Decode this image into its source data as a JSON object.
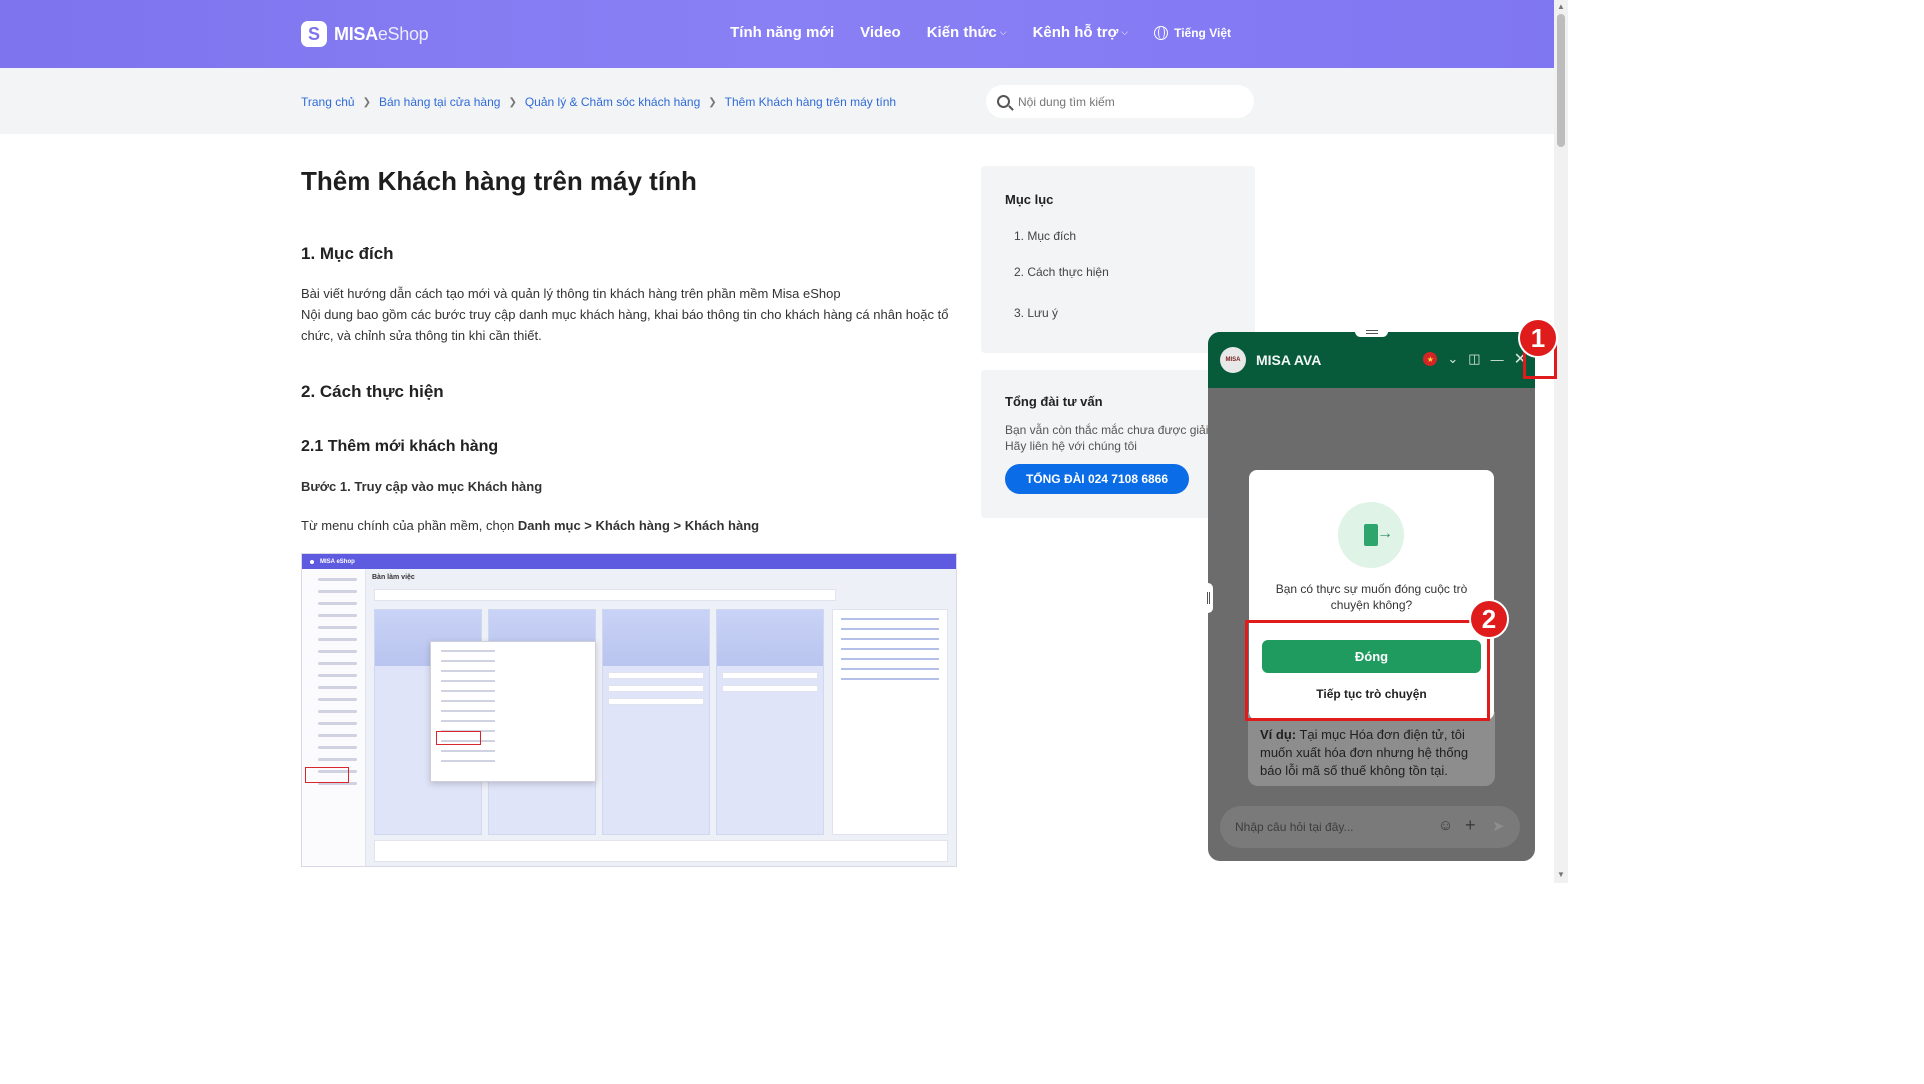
{
  "header": {
    "logo_brand": "MISA",
    "logo_product": "eShop",
    "nav": [
      "Tính năng mới",
      "Video",
      "Kiến thức",
      "Kênh hỗ trợ"
    ],
    "language": "Tiếng Việt"
  },
  "breadcrumb": [
    "Trang chủ",
    "Bán hàng tại cửa hàng",
    "Quản lý & Chăm sóc khách hàng",
    "Thêm Khách hàng trên máy tính"
  ],
  "search": {
    "placeholder": "Nội dung tìm kiếm"
  },
  "article": {
    "title": "Thêm Khách hàng trên máy tính",
    "section1_title": "1. Mục đích",
    "section1_p1": "Bài viết hướng dẫn cách tạo mới và quản lý thông tin khách hàng trên phần mềm Misa eShop",
    "section1_p2": "Nội dung bao gồm các bước truy cập danh mục khách hàng, khai báo thông tin cho khách hàng cá nhân hoặc tổ chức, và chỉnh sửa thông tin khi cần thiết.",
    "section2_title": "2. Cách thực hiện",
    "section21_title": "2.1 Thêm mới khách hàng",
    "step1_title": "Bước 1. Truy cập vào mục Khách hàng",
    "step1_text": "Từ menu chính của phần mềm, chọn ",
    "step1_path": "Danh mục > Khách hàng > Khách hàng",
    "screenshot": {
      "app_title": "Bàn làm việc"
    }
  },
  "toc": {
    "title": "Mục lục",
    "items": [
      "1. Mục đích",
      "2. Cách thực hiện",
      "3. Lưu ý"
    ]
  },
  "hotline": {
    "title": "Tổng đài tư vấn",
    "description": "Bạn vẫn còn thắc mắc chưa được giải đáp? Hãy liên hệ với chúng tôi",
    "button": "TỔNG ĐÀI 024 7108 6866"
  },
  "chat": {
    "name": "MISA AVA",
    "avatar_text": "MISA",
    "message_label": "Ví dụ:",
    "message_text": " Tại mục Hóa đơn điện tử, tôi muốn xuất hóa đơn nhưng hệ thống báo lỗi mã số thuế không tồn tại.",
    "input_placeholder": "Nhập câu hỏi tại đây...",
    "dialog": {
      "question": "Bạn có thực sự muốn đóng cuộc trò chuyện không?",
      "close_button": "Đóng",
      "continue_button": "Tiếp tục trò chuyện"
    }
  },
  "annotations": [
    "1",
    "2"
  ],
  "colors": {
    "header": "#7d74ee",
    "accent_blue": "#0b6ce8",
    "chat_green": "#075a3a",
    "dialog_green": "#1f9b5f",
    "annotation_red": "#e01b1b"
  }
}
